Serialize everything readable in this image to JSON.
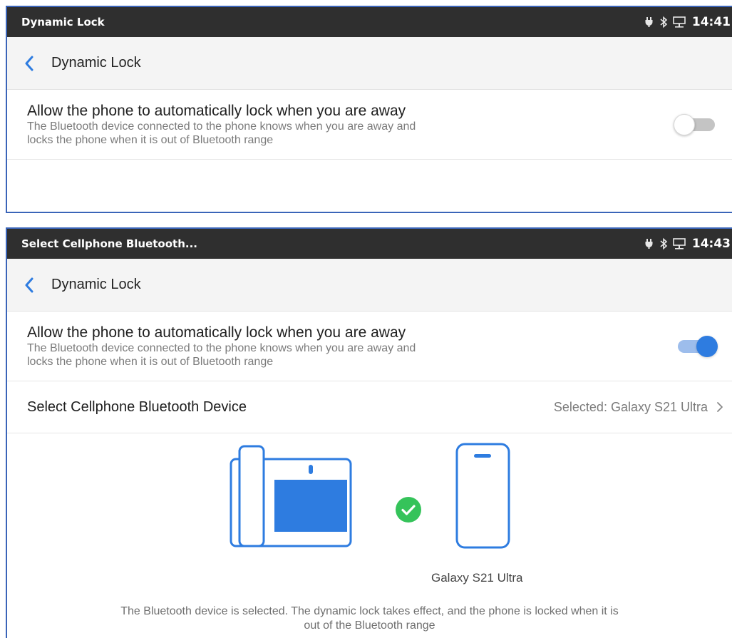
{
  "screen1": {
    "status": {
      "title": "Dynamic Lock",
      "time": "14:41"
    },
    "nav": {
      "title": "Dynamic Lock"
    },
    "setting": {
      "title": "Allow the phone to automatically lock when you are away",
      "description_line1": "The Bluetooth device connected to the phone knows when you are away and",
      "description_line2": "locks the phone when it is out of Bluetooth range",
      "toggle_state": "off"
    }
  },
  "screen2": {
    "status": {
      "title": "Select Cellphone Bluetooth...",
      "time": "14:43"
    },
    "nav": {
      "title": "Dynamic Lock"
    },
    "setting": {
      "title": "Allow the phone to automatically lock when you are away",
      "description_line1": "The Bluetooth device connected to the phone knows when you are away and",
      "description_line2": "locks the phone when it is out of Bluetooth range",
      "toggle_state": "on"
    },
    "select_device": {
      "label": "Select Cellphone Bluetooth Device",
      "value": "Selected: Galaxy S21 Ultra"
    },
    "illustration": {
      "device_name": "Galaxy S21 Ultra",
      "description_line1": "The Bluetooth device is selected. The dynamic lock takes effect, and the phone is locked when it is",
      "description_line2": "out of the Bluetooth range"
    }
  },
  "icons": [
    "power-icon",
    "bluetooth-icon",
    "network-icon",
    "back-chevron-icon",
    "chevron-right-icon",
    "check-circle-icon",
    "desk-phone-icon",
    "cellphone-icon"
  ],
  "colors": {
    "status_bar": "#2f2f2f",
    "nav_bar": "#f4f4f4",
    "accent_blue": "#2e7ce0",
    "toggle_on_track": "#9dbdec",
    "toggle_off_track": "#c4c4c4",
    "check_green": "#35c35a",
    "panel_border": "#3a64b8"
  }
}
